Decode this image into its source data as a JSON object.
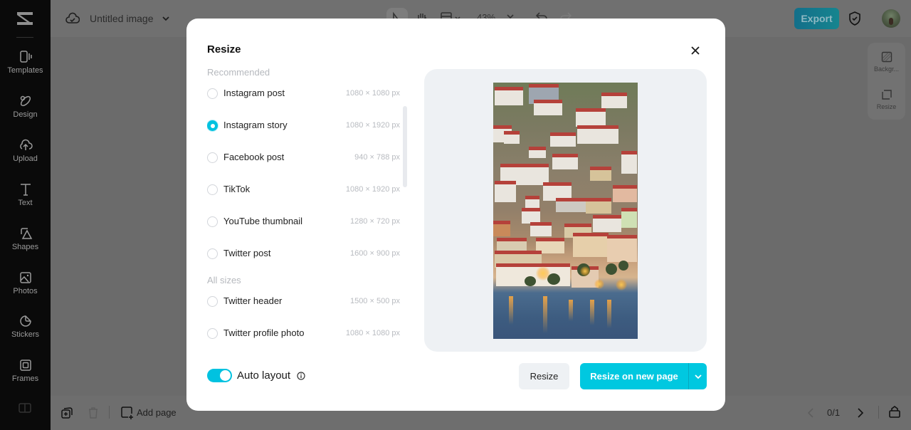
{
  "app": {
    "document_title": "Untitled image",
    "zoom_level": "43%",
    "export_label": "Export",
    "page_indicator": "0/1",
    "add_page_label": "Add page"
  },
  "sidebar": {
    "items": [
      {
        "label": "Templates",
        "icon": "templates-icon"
      },
      {
        "label": "Design",
        "icon": "design-icon"
      },
      {
        "label": "Upload",
        "icon": "upload-icon"
      },
      {
        "label": "Text",
        "icon": "text-icon"
      },
      {
        "label": "Shapes",
        "icon": "shapes-icon"
      },
      {
        "label": "Photos",
        "icon": "photos-icon"
      },
      {
        "label": "Stickers",
        "icon": "stickers-icon"
      },
      {
        "label": "Frames",
        "icon": "frames-icon"
      }
    ]
  },
  "right_panel": {
    "items": [
      {
        "label": "Backgr...",
        "icon": "background-icon"
      },
      {
        "label": "Resize",
        "icon": "resize-icon"
      }
    ]
  },
  "modal": {
    "title": "Resize",
    "recommended_label": "Recommended",
    "all_sizes_label": "All sizes",
    "recommended": [
      {
        "label": "Instagram post",
        "size": "1080 × 1080 px",
        "selected": false
      },
      {
        "label": "Instagram story",
        "size": "1080 × 1920 px",
        "selected": true
      },
      {
        "label": "Facebook post",
        "size": "940 × 788 px",
        "selected": false
      },
      {
        "label": "TikTok",
        "size": "1080 × 1920 px",
        "selected": false
      },
      {
        "label": "YouTube thumbnail",
        "size": "1280 × 720 px",
        "selected": false
      },
      {
        "label": "Twitter post",
        "size": "1600 × 900 px",
        "selected": false
      }
    ],
    "all_sizes": [
      {
        "label": "Twitter header",
        "size": "1500 × 500 px",
        "selected": false
      },
      {
        "label": "Twitter profile photo",
        "size": "1080 × 1080 px",
        "selected": false
      }
    ],
    "auto_layout_label": "Auto layout",
    "auto_layout_on": true,
    "resize_button": "Resize",
    "resize_new_page_button": "Resize on new page",
    "accent_color": "#00c2e0"
  }
}
